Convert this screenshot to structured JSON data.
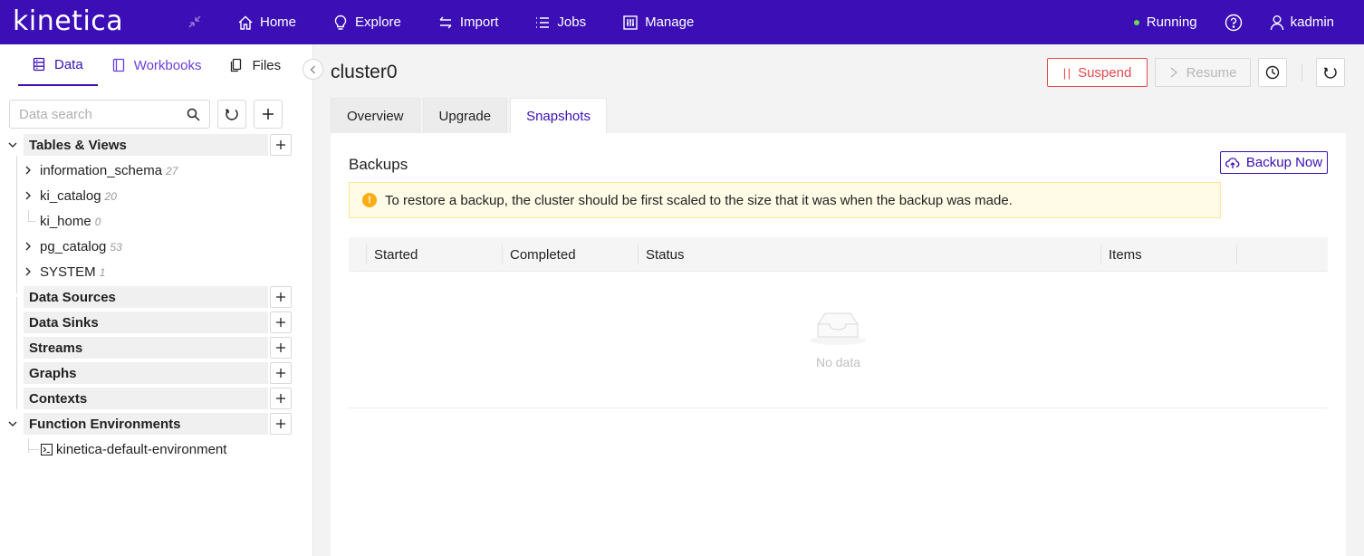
{
  "app": {
    "logo": "kinetica"
  },
  "topnav": {
    "items": [
      {
        "label": "Home",
        "icon": "home-icon"
      },
      {
        "label": "Explore",
        "icon": "lightbulb-icon"
      },
      {
        "label": "Import",
        "icon": "swap-icon"
      },
      {
        "label": "Jobs",
        "icon": "list-icon"
      },
      {
        "label": "Manage",
        "icon": "sliders-icon"
      }
    ],
    "status": "Running",
    "status_color": "#6adb4d",
    "user": "kadmin"
  },
  "sidebar": {
    "tabs": [
      {
        "label": "Data",
        "active": true
      },
      {
        "label": "Workbooks"
      },
      {
        "label": "Files"
      }
    ],
    "search": {
      "placeholder": "Data search"
    },
    "tree": {
      "tables_views": {
        "label": "Tables & Views",
        "children": [
          {
            "label": "information_schema",
            "count": "27"
          },
          {
            "label": "ki_catalog",
            "count": "20"
          },
          {
            "label": "ki_home",
            "count": "0"
          },
          {
            "label": "pg_catalog",
            "count": "53"
          },
          {
            "label": "SYSTEM",
            "count": "1"
          }
        ]
      },
      "groups": [
        {
          "label": "Data Sources"
        },
        {
          "label": "Data Sinks"
        },
        {
          "label": "Streams"
        },
        {
          "label": "Graphs"
        },
        {
          "label": "Contexts"
        }
      ],
      "function_environments": {
        "label": "Function Environments",
        "children": [
          {
            "label": "kinetica-default-environment"
          }
        ]
      }
    }
  },
  "main": {
    "title": "cluster0",
    "actions": {
      "suspend": "Suspend",
      "resume": "Resume"
    },
    "tabs": [
      {
        "label": "Overview"
      },
      {
        "label": "Upgrade"
      },
      {
        "label": "Snapshots",
        "active": true
      }
    ],
    "backups": {
      "title": "Backups",
      "backup_now": "Backup Now",
      "alert": "To restore a backup, the cluster should be first scaled to the size that it was when the backup was made.",
      "columns": [
        "Started",
        "Completed",
        "Status",
        "Items"
      ],
      "empty_text": "No data"
    }
  },
  "colors": {
    "brand": "#3b0fb5",
    "danger": "#e5484d",
    "warning": "#faad14"
  }
}
